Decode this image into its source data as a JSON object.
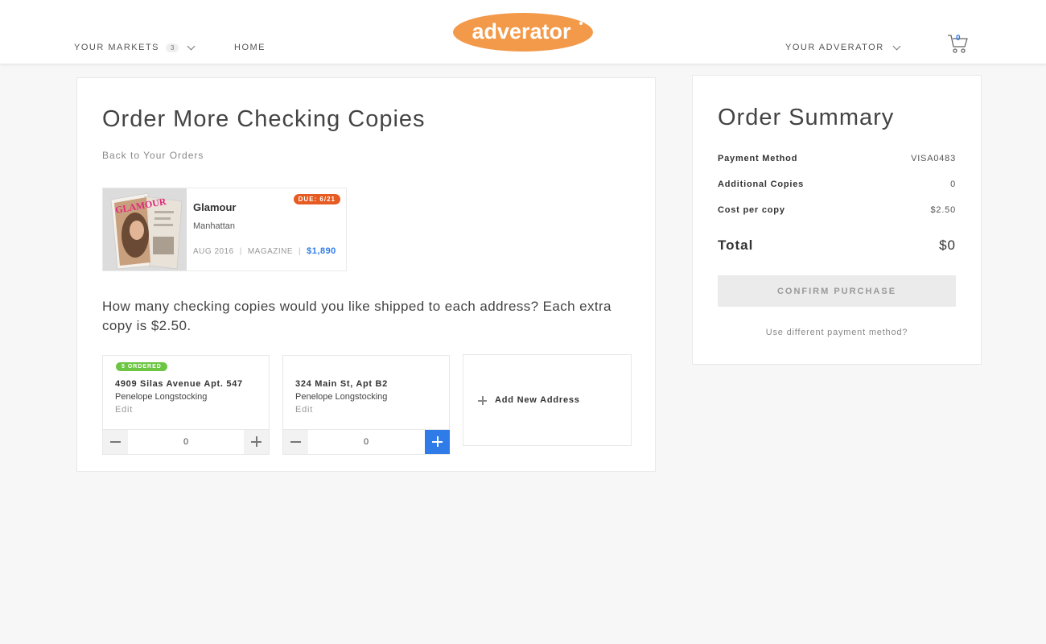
{
  "header": {
    "markets_label": "YOUR MARKETS",
    "markets_count": "3",
    "home_label": "HOME",
    "brand": "adverator",
    "account_label": "YOUR ADVERATOR",
    "cart_count": "0"
  },
  "main": {
    "title": "Order More Checking Copies",
    "back_link": "Back to Your Orders",
    "product": {
      "name": "Glamour",
      "location": "Manhattan",
      "due_badge": "DUE: 6/21",
      "date": "AUG 2016",
      "type": "MAGAZINE",
      "price": "$1,890",
      "cover_text": "GLAMOUR"
    },
    "question": "How many checking copies would you like shipped to each address? Each extra copy is $2.50.",
    "addresses": [
      {
        "badge": "5 ORDERED",
        "street": "4909 Silas Avenue Apt. 547",
        "name": "Penelope Longstocking",
        "edit": "Edit",
        "quantity": "0"
      },
      {
        "badge": "",
        "street": "324 Main St, Apt B2",
        "name": "Penelope Longstocking",
        "edit": "Edit",
        "quantity": "0"
      }
    ],
    "add_address_label": "Add New Address"
  },
  "summary": {
    "title": "Order Summary",
    "payment_method_label": "Payment Method",
    "payment_method_value": "VISA0483",
    "additional_copies_label": "Additional Copies",
    "additional_copies_value": "0",
    "cost_per_copy_label": "Cost per copy",
    "cost_per_copy_value": "$2.50",
    "total_label": "Total",
    "total_value": "$0",
    "confirm_label": "CONFIRM PURCHASE",
    "alt_payment_label": "Use different payment method?"
  },
  "colors": {
    "brand_orange": "#f39a4a",
    "accent_blue": "#2f7ce8",
    "due_orange": "#e55b21",
    "ordered_green": "#6cc644"
  },
  "icons": {
    "cart": "shopping-cart-icon",
    "chevron": "chevron-down-icon",
    "plus": "plus-icon",
    "minus": "minus-icon"
  }
}
